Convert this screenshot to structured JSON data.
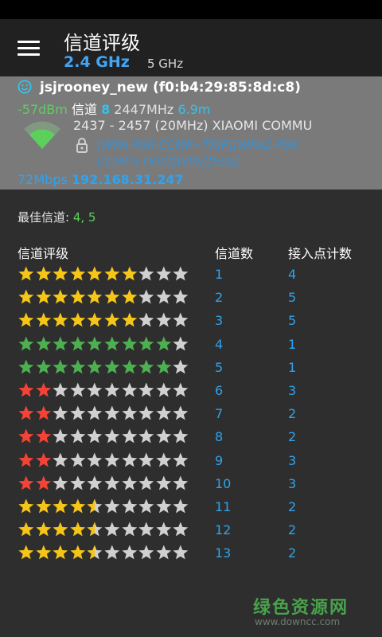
{
  "header": {
    "title": "信道评级",
    "tabs": [
      {
        "label": "2.4 GHz",
        "active": true
      },
      {
        "label": "5 GHz",
        "active": false
      }
    ]
  },
  "connected": {
    "ssid": "jsjrooney_new (f0:b4:29:85:8d:c8)",
    "signal": "-57dBm",
    "channel_label": "信道",
    "channel": "8",
    "frequency": "2447MHz",
    "distance": "6.9m",
    "range": "2437 - 2457 (20MHz)",
    "vendor": "XIAOMI COMMU",
    "security": "[WPA-PSK-CCMP+TKIP][WPA2-PSK-CCMP+TKIP][WPS][ESS]",
    "speed": "72Mbps",
    "ip": "192.168.31.247"
  },
  "best": {
    "label": "最佳信道:",
    "value": "4, 5"
  },
  "table": {
    "headers": [
      "信道评级",
      "信道数",
      "接入点计数"
    ],
    "rows": [
      {
        "rating": 7.0,
        "channel": "1",
        "ap_count": "4",
        "color": "yellow"
      },
      {
        "rating": 7.0,
        "channel": "2",
        "ap_count": "5",
        "color": "yellow"
      },
      {
        "rating": 7.0,
        "channel": "3",
        "ap_count": "5",
        "color": "yellow"
      },
      {
        "rating": 9.0,
        "channel": "4",
        "ap_count": "1",
        "color": "green"
      },
      {
        "rating": 9.0,
        "channel": "5",
        "ap_count": "1",
        "color": "green"
      },
      {
        "rating": 2.0,
        "channel": "6",
        "ap_count": "3",
        "color": "red"
      },
      {
        "rating": 2.0,
        "channel": "7",
        "ap_count": "2",
        "color": "red"
      },
      {
        "rating": 2.0,
        "channel": "8",
        "ap_count": "2",
        "color": "red"
      },
      {
        "rating": 2.0,
        "channel": "9",
        "ap_count": "3",
        "color": "red"
      },
      {
        "rating": 2.0,
        "channel": "10",
        "ap_count": "3",
        "color": "red"
      },
      {
        "rating": 4.5,
        "channel": "11",
        "ap_count": "2",
        "color": "yellow"
      },
      {
        "rating": 4.5,
        "channel": "12",
        "ap_count": "2",
        "color": "yellow"
      },
      {
        "rating": 4.5,
        "channel": "13",
        "ap_count": "2",
        "color": "yellow"
      }
    ],
    "max_stars": 10
  },
  "colors": {
    "yellow": "#f5c518",
    "green": "#4caf50",
    "red": "#f44336",
    "empty": "#d0d0d0",
    "accent": "#2fa3ee"
  },
  "watermark": {
    "brand": "绿色资源网",
    "url": "www.downcc.com"
  }
}
